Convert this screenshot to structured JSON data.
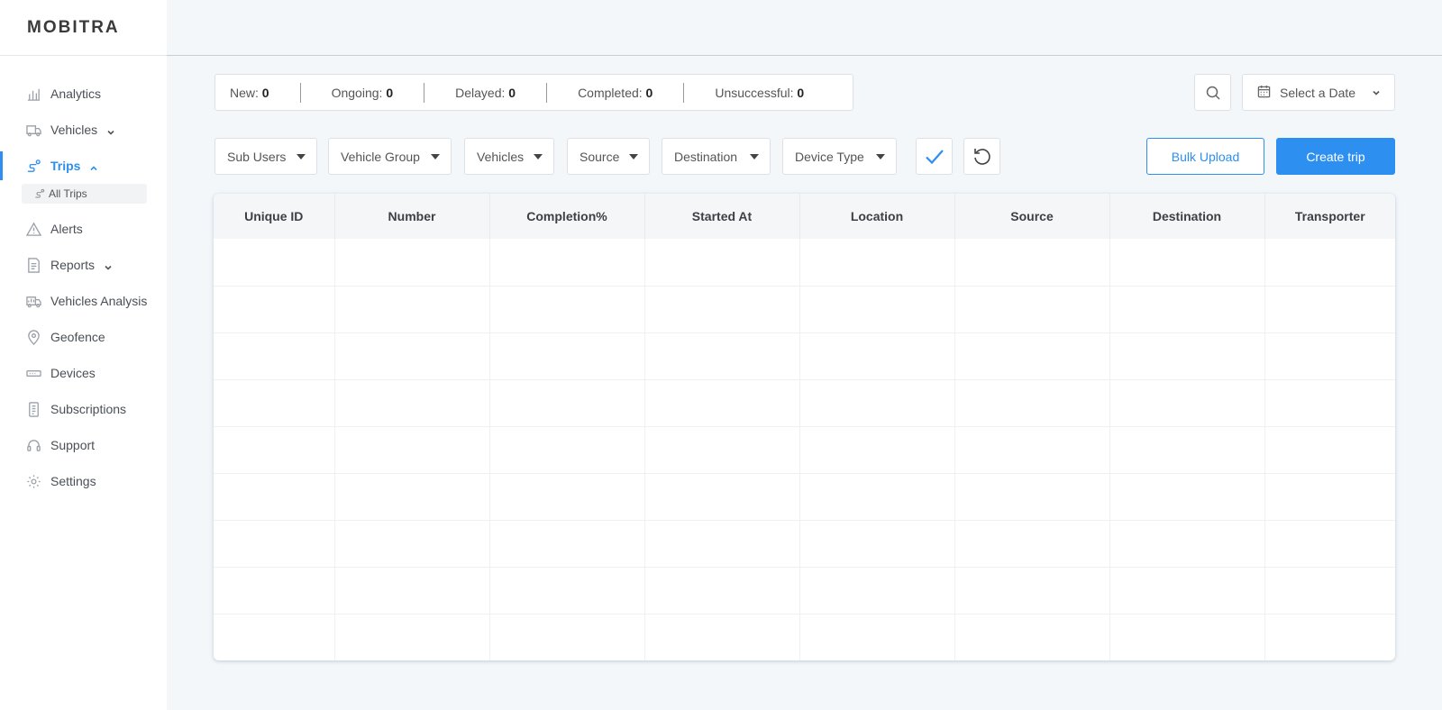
{
  "brand": {
    "name": "MOBITRA"
  },
  "sidebar": {
    "items": [
      {
        "label": "Analytics",
        "icon": "analytics-icon"
      },
      {
        "label": "Vehicles",
        "icon": "truck-icon",
        "expandable": true
      },
      {
        "label": "Trips",
        "icon": "route-icon",
        "expandable": true,
        "active": true,
        "sub": [
          {
            "label": "All Trips"
          }
        ]
      },
      {
        "label": "Alerts",
        "icon": "alert-icon"
      },
      {
        "label": "Reports",
        "icon": "report-icon",
        "expandable": true
      },
      {
        "label": "Vehicles Analysis",
        "icon": "vehicle-analysis-icon"
      },
      {
        "label": "Geofence",
        "icon": "location-pin-icon"
      },
      {
        "label": "Devices",
        "icon": "device-icon"
      },
      {
        "label": "Subscriptions",
        "icon": "subscription-icon"
      },
      {
        "label": "Support",
        "icon": "headset-icon"
      },
      {
        "label": "Settings",
        "icon": "gear-icon"
      }
    ]
  },
  "status": {
    "new_label": "New:",
    "new_count": "0",
    "ongoing_label": "Ongoing:",
    "ongoing_count": "0",
    "delayed_label": "Delayed:",
    "delayed_count": "0",
    "completed_label": "Completed:",
    "completed_count": "0",
    "unsuccessful_label": "Unsuccessful:",
    "unsuccessful_count": "0"
  },
  "toolbar": {
    "date_label": "Select a Date",
    "bulk_upload_label": "Bulk Upload",
    "create_trip_label": "Create trip"
  },
  "filters": [
    {
      "label": "Sub Users"
    },
    {
      "label": "Vehicle Group"
    },
    {
      "label": "Vehicles"
    },
    {
      "label": "Source"
    },
    {
      "label": "Destination"
    },
    {
      "label": "Device Type"
    }
  ],
  "table": {
    "columns": [
      "Unique ID",
      "Number",
      "Completion%",
      "Started At",
      "Location",
      "Source",
      "Destination",
      "Transporter"
    ]
  },
  "colors": {
    "accent": "#2d8ff0",
    "background": "#f4f7fa"
  }
}
